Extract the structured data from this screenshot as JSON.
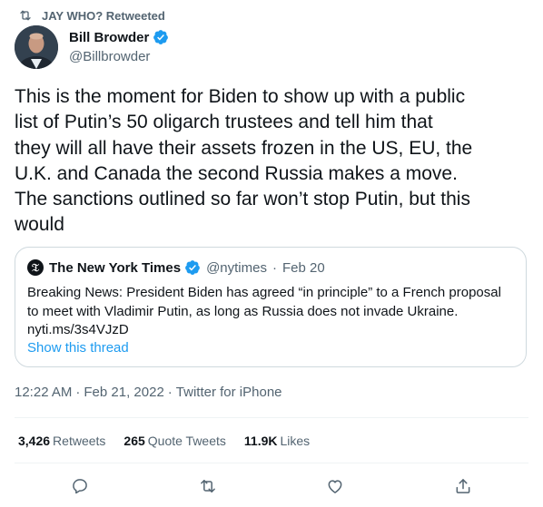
{
  "retweet": {
    "label": "JAY WHO? Retweeted",
    "icon": "retweet-icon"
  },
  "author": {
    "name": "Bill Browder",
    "handle": "@Billbrowder",
    "verified": true,
    "verified_icon": "verified-badge-icon"
  },
  "tweet": {
    "text": "This is the moment for Biden to show up with a public\nlist of Putin’s 50 oligarch trustees and tell him that\nthey will all have their assets frozen in the US, EU, the\nU.K. and Canada the second Russia makes a move.\nThe sanctions outlined so far won’t stop Putin, but this\nwould"
  },
  "quote": {
    "name": "The New York Times",
    "handle": "@nytimes",
    "separator": "·",
    "date": "Feb 20",
    "text": "Breaking News: President Biden has agreed “in principle” to a French proposal\nto meet with Vladimir Putin, as long as Russia does not invade Ukraine.\nnyti.ms/3s4VJzD",
    "show_thread": "Show this thread"
  },
  "meta": {
    "time": "12:22 AM",
    "sep1": "·",
    "date": "Feb 21, 2022",
    "sep2": "·",
    "source": "Twitter for iPhone"
  },
  "stats": {
    "retweets_count": "3,426",
    "retweets_label": "Retweets",
    "quotes_count": "265",
    "quotes_label": "Quote Tweets",
    "likes_count": "11.9K",
    "likes_label": "Likes"
  },
  "actions": [
    "reply-icon",
    "retweet-icon",
    "like-icon",
    "share-icon"
  ],
  "colors": {
    "text": "#0f1419",
    "secondary": "#536471",
    "link": "#1d9bf0",
    "border": "#cfd9de",
    "divider": "#eff3f4"
  }
}
